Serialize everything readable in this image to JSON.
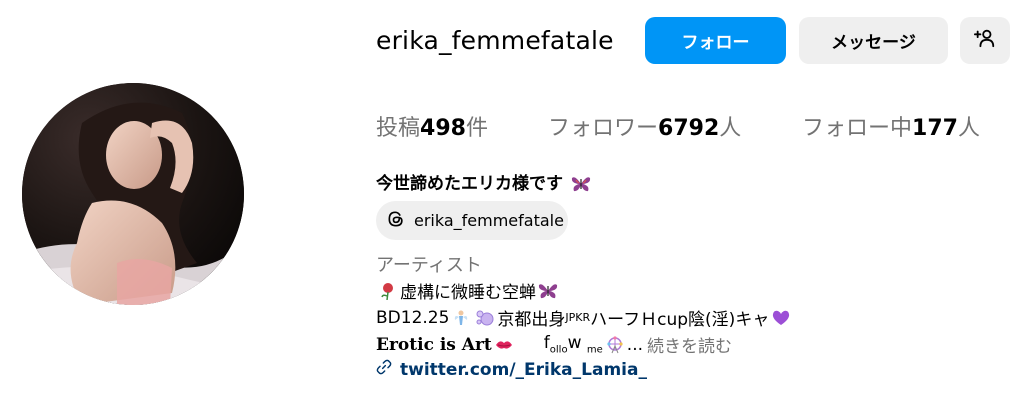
{
  "header": {
    "username": "erika_femmefatale",
    "follow_label": "フォロー",
    "message_label": "メッセージ",
    "suggest_icon": "person-add-icon"
  },
  "stats": {
    "posts_prefix": "投稿",
    "posts_count": "498",
    "posts_suffix": "件",
    "followers_prefix": "フォロワー",
    "followers_count": "6792",
    "followers_suffix": "人",
    "following_prefix": "フォロー中",
    "following_count": "177",
    "following_suffix": "人"
  },
  "bio": {
    "full_name": "今世諦めたエリカ様です",
    "threads_handle": "erika_femmefatale",
    "category": "アーティスト",
    "line1": "虚構に微睡む空蝉",
    "line2_a": "BD12.25",
    "line2_b": "京都出身",
    "line2_small": "JPKR",
    "line2_c": "ハーフＨcup陰(淫)キャ",
    "line3_bold": "Erotic is Art",
    "line3_follow_a": "f",
    "line3_follow_sub1": "ollo",
    "line3_follow_b": "w ",
    "line3_follow_sub2": "me",
    "line3_ellipsis": "...",
    "more_label": "続きを読む",
    "link": "twitter.com/_Erika_Lamia_"
  },
  "colors": {
    "accent": "#0095f6",
    "secondary_button": "#efefef",
    "muted_text": "#737373",
    "link": "#00376b"
  }
}
